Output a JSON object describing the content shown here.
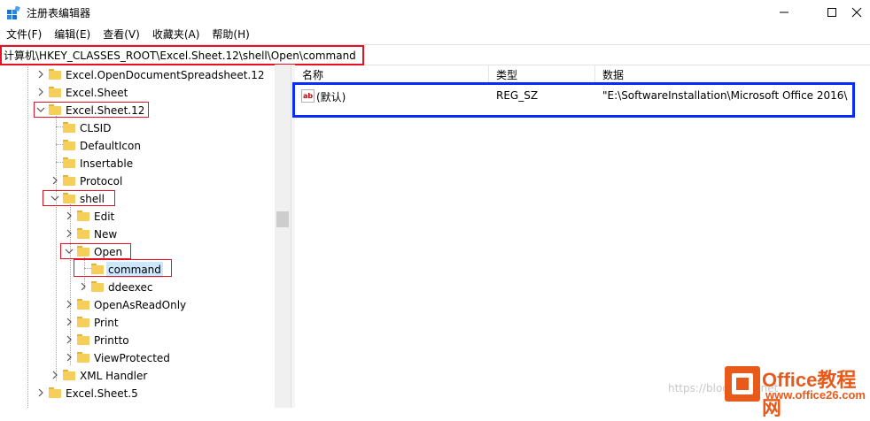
{
  "window": {
    "title": "注册表编辑器",
    "icon": "registry-editor-icon"
  },
  "menu": [
    "文件(F)",
    "编辑(E)",
    "查看(V)",
    "收藏夹(A)",
    "帮助(H)"
  ],
  "address": {
    "path": "计算机\\HKEY_CLASSES_ROOT\\Excel.Sheet.12\\shell\\Open\\command"
  },
  "tree": {
    "items": [
      {
        "label": "Excel.OpenDocumentSpreadsheet.12",
        "state": "collapsed"
      },
      {
        "label": "Excel.Sheet",
        "state": "collapsed"
      },
      {
        "label": "Excel.Sheet.12",
        "state": "expanded"
      },
      {
        "label": "CLSID",
        "state": "leaf"
      },
      {
        "label": "DefaultIcon",
        "state": "leaf"
      },
      {
        "label": "Insertable",
        "state": "leaf"
      },
      {
        "label": "Protocol",
        "state": "collapsed"
      },
      {
        "label": "shell",
        "state": "expanded"
      },
      {
        "label": "Edit",
        "state": "collapsed"
      },
      {
        "label": "New",
        "state": "collapsed"
      },
      {
        "label": "Open",
        "state": "expanded"
      },
      {
        "label": "command",
        "state": "selected"
      },
      {
        "label": "ddeexec",
        "state": "collapsed"
      },
      {
        "label": "OpenAsReadOnly",
        "state": "collapsed"
      },
      {
        "label": "Print",
        "state": "collapsed"
      },
      {
        "label": "Printto",
        "state": "collapsed"
      },
      {
        "label": "ViewProtected",
        "state": "collapsed"
      },
      {
        "label": "XML Handler",
        "state": "collapsed"
      },
      {
        "label": "Excel.Sheet.5",
        "state": "collapsed"
      }
    ]
  },
  "values": {
    "columns": {
      "name": "名称",
      "type": "类型",
      "data": "数据"
    },
    "rows": [
      {
        "name": "(默认)",
        "type": "REG_SZ",
        "data": "\"E:\\SoftwareInstallation\\Microsoft Office 2016\\",
        "icon": "ab-string-icon"
      }
    ]
  },
  "watermark": {
    "url": "https://blog.csdn.net",
    "logo_text": "Office教程网",
    "logo_url": "www.office26.com"
  },
  "colors": {
    "highlight_red": "#e81123",
    "highlight_blue": "#0a2bff",
    "selection": "#cce8ff",
    "folder": "#f5cf5a",
    "logo_orange": "#e85a1a"
  }
}
